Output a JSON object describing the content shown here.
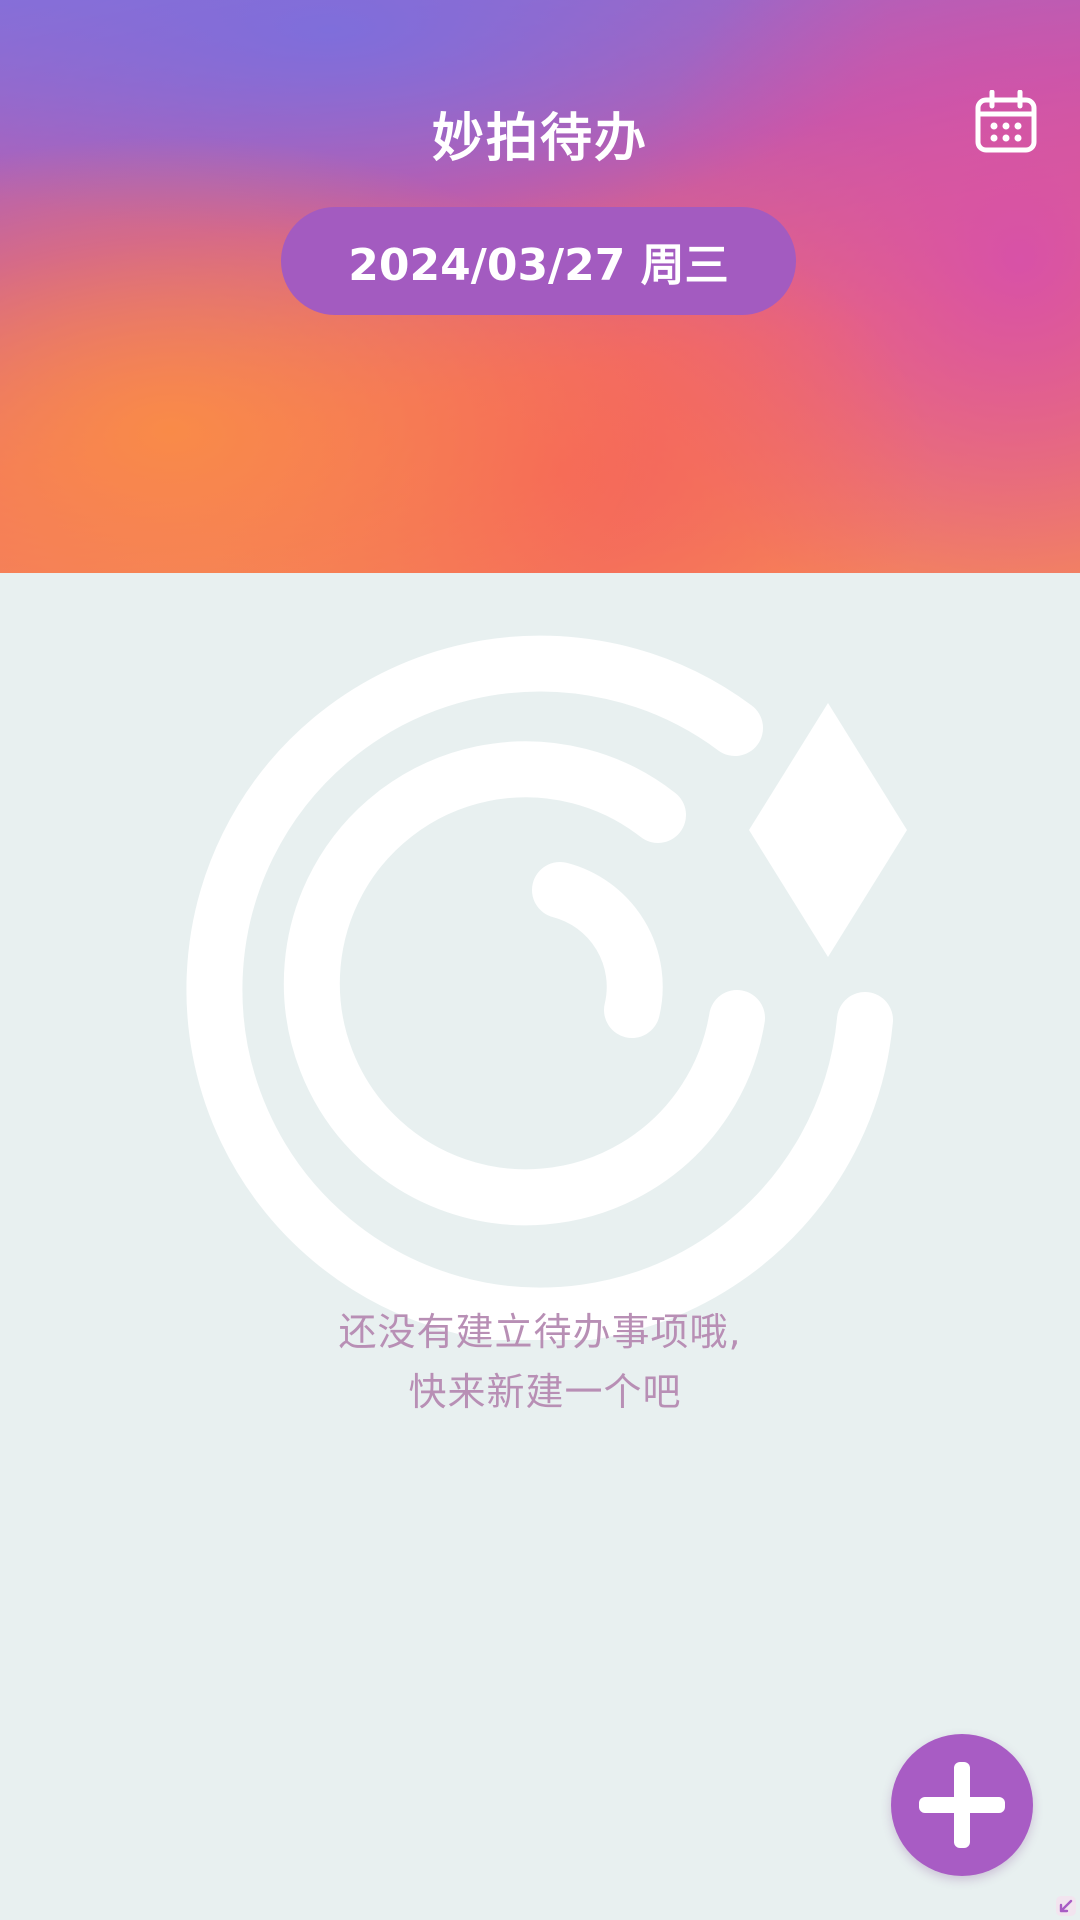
{
  "header": {
    "title": "妙拍待办",
    "date_label": "2024/03/27 周三",
    "calendar_icon": "calendar-icon"
  },
  "empty_state": {
    "line1": "还没有建立待办事项哦,",
    "line2": "快来新建一个吧",
    "illustration_icon": "empty-logo-icon"
  },
  "fab": {
    "icon": "plus-icon"
  },
  "colors": {
    "background": "#e8f0f0",
    "accent_purple": "#a85cc4",
    "date_pill": "#a35bc0",
    "empty_text": "#b88fb5",
    "gradient_orange": "#f78a55",
    "gradient_coral": "#f0706a",
    "gradient_pink": "#d650aa",
    "gradient_violet": "#8b6fd6"
  }
}
